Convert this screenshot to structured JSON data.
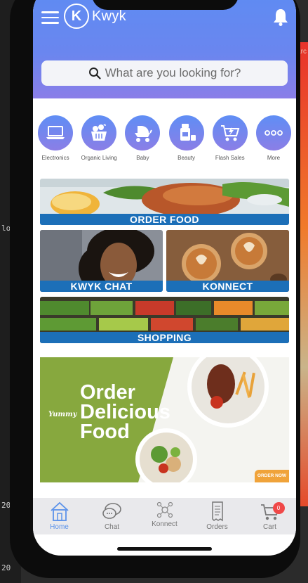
{
  "background": {
    "right_text": "arc",
    "left_texts": [
      "lo",
      "20",
      "20"
    ]
  },
  "header": {
    "logo_mark": "K",
    "app_name": "Kwyk",
    "gradient_top": "#5d8cf3",
    "gradient_bottom": "#8a7ee8"
  },
  "search": {
    "placeholder": "What are you looking for?"
  },
  "categories": [
    {
      "label": "Electronics",
      "icon": "laptop-icon"
    },
    {
      "label": "Organic Living",
      "icon": "basket-icon"
    },
    {
      "label": "Baby",
      "icon": "stroller-icon"
    },
    {
      "label": "Beauty",
      "icon": "cosmetics-icon"
    },
    {
      "label": "Flash Sales",
      "icon": "cart-flash-icon"
    },
    {
      "label": "More",
      "icon": "more-dots-icon"
    }
  ],
  "tiles": {
    "order_food": "ORDER FOOD",
    "kwyk_chat": "KWYK CHAT",
    "konnect": "KONNECT",
    "shopping": "SHOPPING"
  },
  "promo": {
    "headline": [
      "Order",
      "Delicious",
      "Food"
    ],
    "brand": "Yummy",
    "button": "ORDER NOW"
  },
  "tabbar": [
    {
      "label": "Home",
      "icon": "home-icon",
      "active": true
    },
    {
      "label": "Chat",
      "icon": "chat-icon",
      "active": false
    },
    {
      "label": "Konnect",
      "icon": "konnect-icon",
      "active": false
    },
    {
      "label": "Orders",
      "icon": "receipt-icon",
      "active": false
    },
    {
      "label": "Cart",
      "icon": "cart-icon",
      "active": false,
      "badge": "0"
    }
  ],
  "colors": {
    "accent": "#5b92ea",
    "caption_bar": "#1c6fb8",
    "promo_green": "#87a83e",
    "promo_button": "#f0a33a",
    "badge": "#f04848"
  }
}
